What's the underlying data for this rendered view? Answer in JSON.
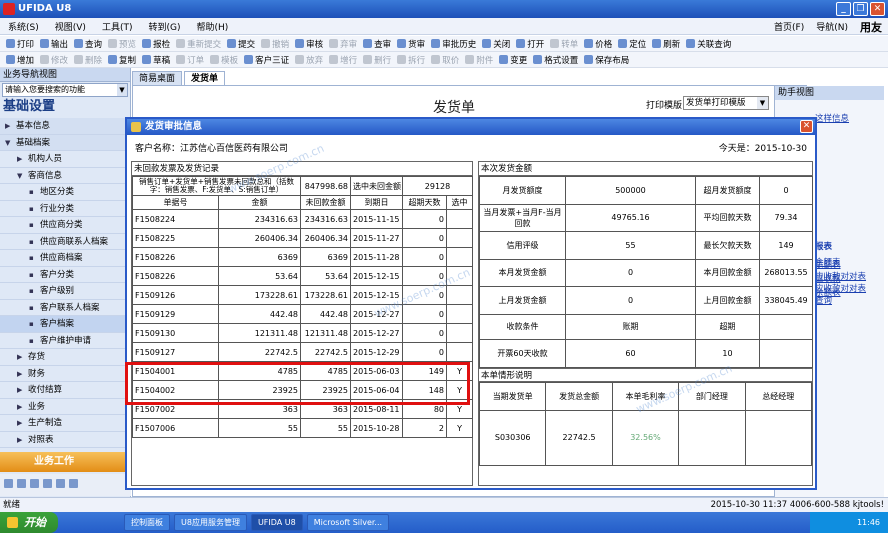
{
  "app": {
    "title": "UFIDA U8",
    "menus": [
      "系统(S)",
      "视图(V)",
      "工具(T)",
      "转到(G)",
      "帮助(H)"
    ],
    "right_links": [
      "首页(F)",
      "导航(N)"
    ],
    "brand": "用友"
  },
  "toolbar1": [
    "打印",
    "输出",
    "查询",
    "预览",
    "报检",
    "重新提交",
    "提交",
    "撤销",
    "审核",
    "弃审",
    "查审",
    "货审",
    "审批历史",
    "关闭",
    "打开",
    "转单",
    "价格",
    "定位",
    "刷新",
    "关联查询"
  ],
  "toolbar2": [
    "增加",
    "修改",
    "删除",
    "复制",
    "草稿",
    "订单",
    "模板",
    "客户三证",
    "放弃",
    "增行",
    "删行",
    "拆行",
    "取价",
    "附件",
    "变更",
    "格式设置",
    "保存布局"
  ],
  "left": {
    "header": "业务导航视图",
    "search_placeholder": "请输入您要搜索的功能",
    "section_title": "基础设置",
    "tree": [
      {
        "label": "基本信息",
        "level": 0
      },
      {
        "label": "基础档案",
        "level": 0
      },
      {
        "label": "机构人员",
        "level": 1
      },
      {
        "label": "客商信息",
        "level": 1
      },
      {
        "label": "地区分类",
        "level": 2
      },
      {
        "label": "行业分类",
        "level": 2
      },
      {
        "label": "供应商分类",
        "level": 2
      },
      {
        "label": "供应商联系人档案",
        "level": 2
      },
      {
        "label": "供应商档案",
        "level": 2
      },
      {
        "label": "客户分类",
        "level": 2
      },
      {
        "label": "客户级别",
        "level": 2
      },
      {
        "label": "客户联系人档案",
        "level": 2
      },
      {
        "label": "客户档案",
        "level": 2
      },
      {
        "label": "客户维护申请",
        "level": 2
      },
      {
        "label": "存货",
        "level": 1
      },
      {
        "label": "财务",
        "level": 1
      },
      {
        "label": "收付结算",
        "level": 1
      },
      {
        "label": "业务",
        "level": 1
      },
      {
        "label": "生产制造",
        "level": 1
      },
      {
        "label": "对照表",
        "level": 1
      }
    ],
    "bottom_button": "业务工作"
  },
  "tabs": [
    "简易桌面",
    "发货单"
  ],
  "doc": {
    "title": "发货单",
    "print_template_label": "打印模版",
    "print_template_value": "发货单打印模版"
  },
  "right_pane": {
    "header": "助手视图",
    "items": [
      "这样信息",
      "余额表",
      "应收款",
      "余额表",
      "报表",
      "余额表",
      "应收款对对表",
      "应收款对对表",
      "查询"
    ]
  },
  "dialog": {
    "title": "发货审批信息",
    "customer_label": "客户名称：江苏信心百信医药有限公司",
    "today_label": "今天是：2015-10-30",
    "left_panel": {
      "header": "未回款发票及发货记录",
      "summary_label": "销售订单+发货单+销售发票未回款总和（括数字：销售发票、F:发货单、S:销售订单）",
      "summary_value": "847998.68",
      "selected_label": "选中未回金额",
      "selected_value": "29128",
      "columns": [
        "单据号",
        "金额",
        "未回款金额",
        "到期日",
        "超期天数",
        "选中"
      ],
      "rows": [
        [
          "F1508224",
          "234316.63",
          "234316.63",
          "2015-11-15",
          "0",
          ""
        ],
        [
          "F1508225",
          "260406.34",
          "260406.34",
          "2015-11-27",
          "0",
          ""
        ],
        [
          "F1508226",
          "6369",
          "6369",
          "2015-11-28",
          "0",
          ""
        ],
        [
          "F1508226",
          "53.64",
          "53.64",
          "2015-12-15",
          "0",
          ""
        ],
        [
          "F1509126",
          "173228.61",
          "173228.61",
          "2015-12-15",
          "0",
          ""
        ],
        [
          "F1509129",
          "442.48",
          "442.48",
          "2015-12-27",
          "0",
          ""
        ],
        [
          "F1509130",
          "121311.48",
          "121311.48",
          "2015-12-27",
          "0",
          ""
        ],
        [
          "F1509127",
          "22742.5",
          "22742.5",
          "2015-12-29",
          "0",
          ""
        ],
        [
          "F1504001",
          "4785",
          "4785",
          "2015-06-03",
          "149",
          "Y"
        ],
        [
          "F1504002",
          "23925",
          "23925",
          "2015-06-04",
          "148",
          "Y"
        ],
        [
          "F1507002",
          "363",
          "363",
          "2015-08-11",
          "80",
          "Y"
        ],
        [
          "F1507006",
          "55",
          "55",
          "2015-10-28",
          "2",
          "Y"
        ]
      ]
    },
    "right_panel": {
      "header": "本次发货金额",
      "metrics": [
        [
          "月发货额度",
          "500000",
          "超月发货额度",
          "0"
        ],
        [
          "当月发票+当月F-当月回款",
          "49765.16",
          "平均回款天数",
          "79.34"
        ],
        [
          "信用评级",
          "55",
          "最长欠款天数",
          "149"
        ],
        [
          "本月发货金额",
          "0",
          "本月回款金额",
          "268013.55"
        ],
        [
          "上月发货金额",
          "0",
          "上月回款金额",
          "338045.49"
        ]
      ],
      "terms_label": "收款条件",
      "terms_cols": [
        "账期",
        "超期"
      ],
      "terms_row_label": "开票60天收款",
      "terms_values": [
        "60",
        "10"
      ],
      "reason_header": "本单情形说明",
      "reason_cols": [
        "当期发货单",
        "发货总金额",
        "本单毛利率",
        "部门经理",
        "总经经理"
      ],
      "reason_row": [
        "S030306",
        "22742.5",
        "32.56%",
        "",
        ""
      ]
    }
  },
  "watermark": "www.soerp.com.cn",
  "status": {
    "left": "就绪",
    "right": "2015-10-30  11:37  4006-600-588  kjtools!"
  },
  "taskbar": {
    "start": "开始",
    "tasks": [
      "控制面板",
      "U8应用服务管理",
      "UFIDA U8",
      "Microsoft Silver..."
    ],
    "clock": "11:46"
  },
  "colors": {
    "title_blue": "#2558c6",
    "highlight_red": "#e01010",
    "nav_orange": "#e38d16"
  }
}
